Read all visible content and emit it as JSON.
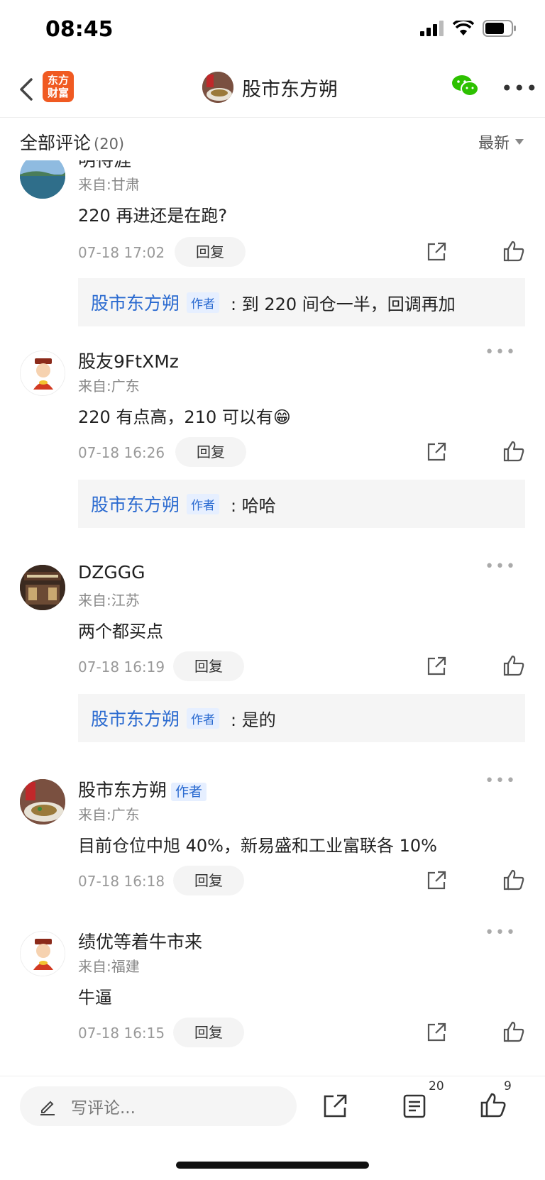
{
  "status_bar": {
    "time": "08:45"
  },
  "nav": {
    "app_logo_text": "东方财富",
    "title": "股市东方朔"
  },
  "section": {
    "title": "全部评论",
    "count": "(20)",
    "sort_label": "最新"
  },
  "comments": [
    {
      "username": "明待涯",
      "location": "来自:甘肃",
      "text": "220 再进还是在跑?",
      "time": "07-18 17:02",
      "reply_label": "回复",
      "reply": {
        "author": "股市东方朔",
        "tag": "作者",
        "text": ":  到 220 间仓一半，回调再加"
      }
    },
    {
      "username": "股友9FtXMz",
      "location": "来自:广东",
      "text": "220 有点高，210 可以有",
      "emoji": "😁",
      "time": "07-18 16:26",
      "reply_label": "回复",
      "reply": {
        "author": "股市东方朔",
        "tag": "作者",
        "text": ":  哈哈"
      }
    },
    {
      "username": "DZGGG",
      "location": "来自:江苏",
      "text": "两个都买点",
      "time": "07-18 16:19",
      "reply_label": "回复",
      "reply": {
        "author": "股市东方朔",
        "tag": "作者",
        "text": ":  是的"
      }
    },
    {
      "username": "股市东方朔",
      "user_tag": "作者",
      "location": "来自:广东",
      "text": "目前仓位中旭 40%，新易盛和工业富联各 10%",
      "time": "07-18 16:18",
      "reply_label": "回复"
    },
    {
      "username": "绩优等着牛市来",
      "location": "来自:福建",
      "text": "牛逼",
      "time": "07-18 16:15",
      "reply_label": "回复"
    }
  ],
  "bottom_bar": {
    "placeholder": "写评论...",
    "comment_count": "20",
    "like_count": "9"
  },
  "colors": {
    "accent_blue": "#2a6ad0",
    "brand_orange": "#f05a22",
    "wechat_green": "#2dc100"
  }
}
